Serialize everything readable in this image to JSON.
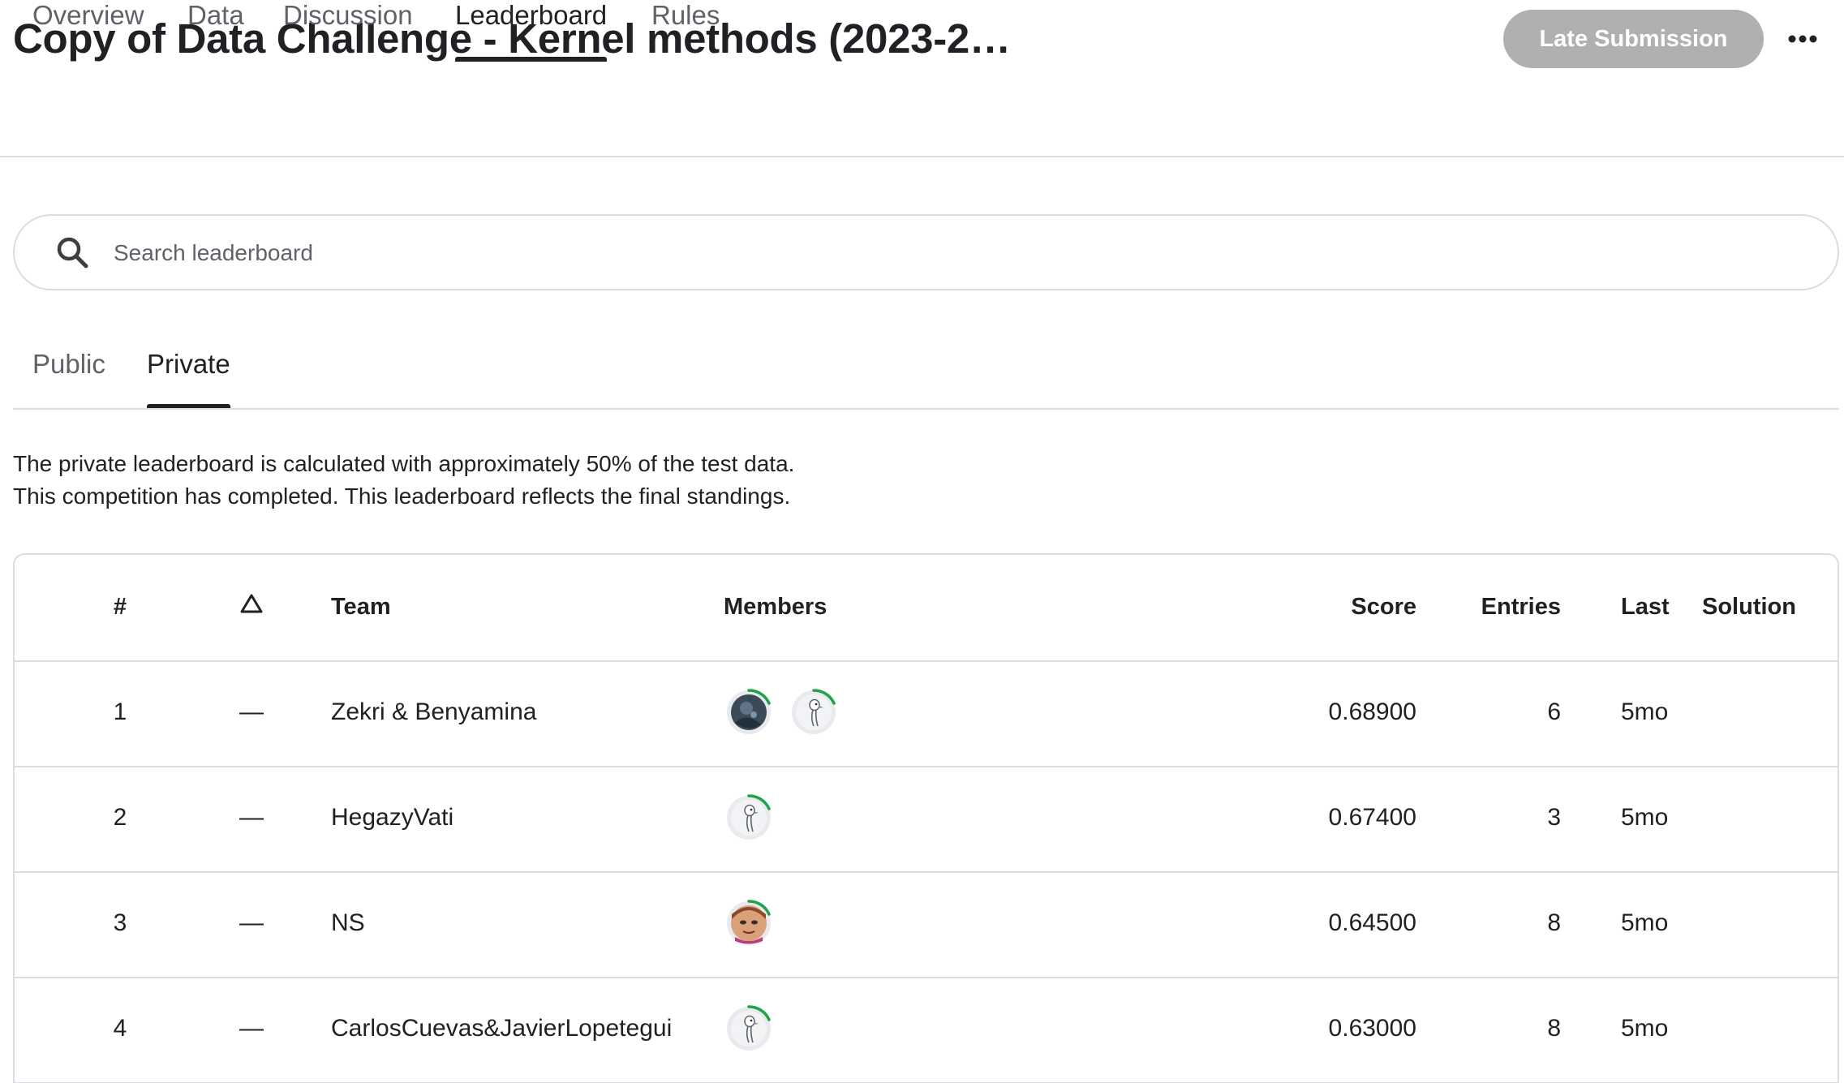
{
  "header": {
    "title": "Copy of Data Challenge - Kernel methods (2023-2…",
    "late_submission_label": "Late Submission",
    "more_icon": "more-horizontal-icon"
  },
  "tabs": [
    {
      "label": "Overview"
    },
    {
      "label": "Data"
    },
    {
      "label": "Discussion"
    },
    {
      "label": "Leaderboard",
      "active": true
    },
    {
      "label": "Rules"
    }
  ],
  "search": {
    "placeholder": "Search leaderboard",
    "icon": "search-icon",
    "value": ""
  },
  "subtabs": [
    {
      "label": "Public"
    },
    {
      "label": "Private",
      "active": true
    }
  ],
  "info": {
    "line1": "The private leaderboard is calculated with approximately 50% of the test data.",
    "line2": "This competition has completed. This leaderboard reflects the final standings."
  },
  "table": {
    "columns": {
      "rank": "#",
      "delta_icon": "triangle-icon",
      "team": "Team",
      "members": "Members",
      "score": "Score",
      "entries": "Entries",
      "last": "Last",
      "solution": "Solution"
    },
    "rows": [
      {
        "rank": "1",
        "delta": "—",
        "team": "Zekri & Benyamina",
        "members": [
          "photo-avatar",
          "goose-avatar"
        ],
        "score": "0.68900",
        "entries": "6",
        "last": "5mo"
      },
      {
        "rank": "2",
        "delta": "—",
        "team": "HegazyVati",
        "members": [
          "goose-avatar"
        ],
        "score": "0.67400",
        "entries": "3",
        "last": "5mo"
      },
      {
        "rank": "3",
        "delta": "—",
        "team": "NS",
        "members": [
          "cartoon-face-avatar"
        ],
        "score": "0.64500",
        "entries": "8",
        "last": "5mo"
      },
      {
        "rank": "4",
        "delta": "—",
        "team": "CarlosCuevas&JavierLopetegui",
        "members": [
          "goose-avatar"
        ],
        "score": "0.63000",
        "entries": "8",
        "last": "5mo"
      }
    ]
  },
  "colors": {
    "text": "#202124",
    "muted": "#5f6368",
    "border": "#dadce0",
    "button_disabled": "#b0b0b0",
    "progress_ring": "#1ea446"
  }
}
